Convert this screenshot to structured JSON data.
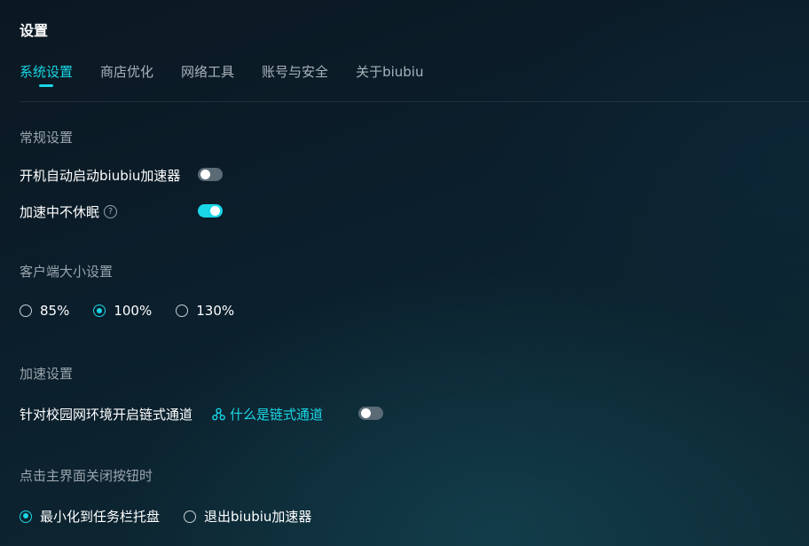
{
  "page": {
    "title": "设置"
  },
  "tabs": [
    {
      "label": "系统设置",
      "active": true
    },
    {
      "label": "商店优化"
    },
    {
      "label": "网络工具"
    },
    {
      "label": "账号与安全"
    },
    {
      "label": "关于biubiu"
    }
  ],
  "general": {
    "title": "常规设置",
    "autostart_label": "开机自动启动biubiu加速器",
    "autostart_on": false,
    "nosleep_label": "加速中不休眠",
    "nosleep_on": true
  },
  "size": {
    "title": "客户端大小设置",
    "options": [
      "85%",
      "100%",
      "130%"
    ],
    "selected": "100%"
  },
  "accel": {
    "title": "加速设置",
    "campus_label": "针对校园网环境开启链式通道",
    "link_label": "什么是链式通道",
    "campus_on": false
  },
  "close": {
    "title": "点击主界面关闭按钮时",
    "options": [
      "最小化到任务栏托盘",
      "退出biubiu加速器"
    ],
    "selected": "最小化到任务栏托盘"
  },
  "colors": {
    "accent": "#19d7e6",
    "muted": "#9aa5ad"
  }
}
